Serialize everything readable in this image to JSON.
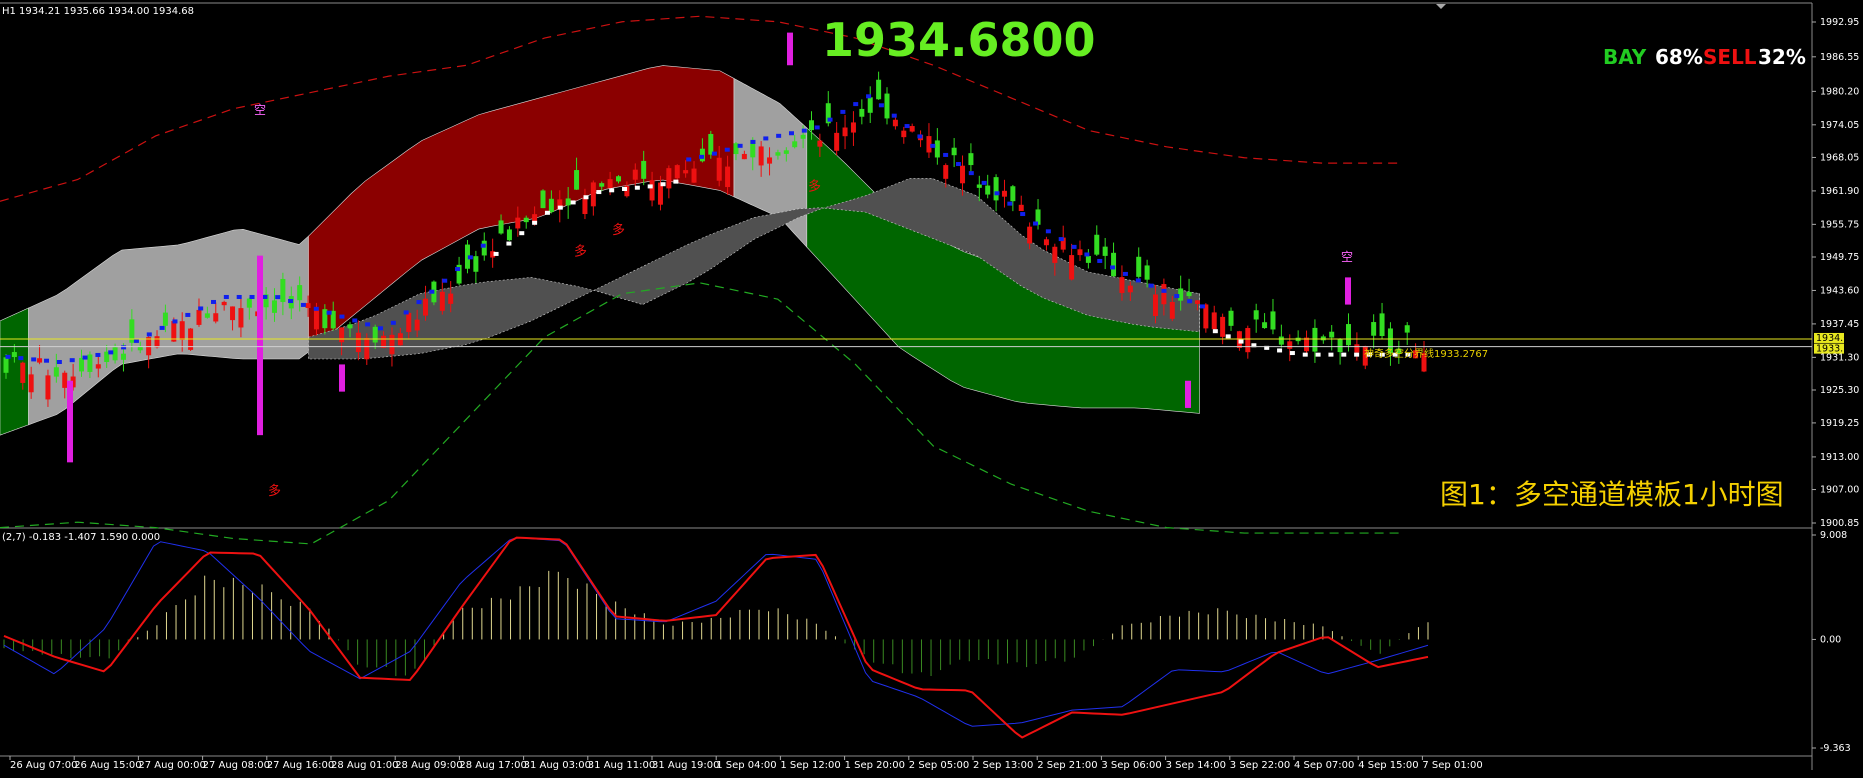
{
  "header": {
    "ohlc_info": "H1  1934.21 1935.66 1934.00 1934.68",
    "osc_info": "(2,7) -0.183 -1.407 1.590 0.000",
    "big_price": "1934.6800",
    "caption": "图1：多空通道模板1小时图",
    "level_label": "神奇多空分界线1933.2767",
    "bay_label": "BAY",
    "bay_value": "68%",
    "sell_label": "SELL",
    "sell_value": "32%",
    "signal_up": "多",
    "signal_down": "空"
  },
  "price_tags": {
    "current": "1934.68",
    "level": "1933.28"
  },
  "colors": {
    "background": "#000000",
    "bull_candle": "#33dd22",
    "bear_candle": "#ee1111",
    "red_band": "#8b0000",
    "green_band": "#006600",
    "gray_band": "#a0a0a0",
    "dark_band": "#555555",
    "blue_trail": "#1020ee",
    "magenta_spike": "#e020e0",
    "yellow_level": "#e8e820"
  },
  "chart_data": [
    {
      "type": "candlestick",
      "title": "",
      "ylim": [
        1900.85,
        1992.95
      ],
      "y_ticks": [
        "1992.95",
        "1986.55",
        "1980.20",
        "1974.05",
        "1968.05",
        "1961.90",
        "1955.75",
        "1949.75",
        "1943.60",
        "1937.45",
        "1931.30",
        "1925.30",
        "1919.25",
        "1913.00",
        "1907.00",
        "1900.85"
      ],
      "x_ticks": [
        "26 Aug 07:00",
        "26 Aug 15:00",
        "27 Aug 00:00",
        "27 Aug 08:00",
        "27 Aug 16:00",
        "28 Aug 01:00",
        "28 Aug 09:00",
        "28 Aug 17:00",
        "31 Aug 03:00",
        "31 Aug 11:00",
        "31 Aug 19:00",
        "1 Sep 04:00",
        "1 Sep 12:00",
        "1 Sep 20:00",
        "2 Sep 05:00",
        "2 Sep 13:00",
        "2 Sep 21:00",
        "3 Sep 06:00",
        "3 Sep 14:00",
        "3 Sep 22:00",
        "4 Sep 07:00",
        "4 Sep 15:00",
        "7 Sep 01:00"
      ],
      "current_price": 1934.68,
      "level_price": 1933.2767,
      "mid_line": [
        1930,
        1929,
        1931,
        1936,
        1941,
        1941,
        1938,
        1935,
        1943,
        1952,
        1960,
        1964,
        1965,
        1967,
        1970,
        1972,
        1978,
        1970,
        1963,
        1955,
        1949,
        1944,
        1940,
        1936,
        1934,
        1934,
        1934
      ],
      "upper_band": [
        1938,
        1943,
        1951,
        1952,
        1955,
        1952,
        1963,
        1971,
        1976,
        1979,
        1982,
        1985,
        1984,
        1978,
        1968,
        1957,
        1951,
        1947,
        1944,
        1943,
        1943
      ],
      "lower_band": [
        1917,
        1921,
        1930,
        1932,
        1931,
        1931,
        1940,
        1949,
        1955,
        1957,
        1962,
        1964,
        1962,
        1957,
        1945,
        1933,
        1926,
        1923,
        1922,
        1922,
        1921
      ]
    },
    {
      "type": "oscillator",
      "ylim": [
        -9.363,
        9.008
      ],
      "y_ticks": [
        "9.008",
        "0.00",
        "-9.363"
      ],
      "red_line": [
        0.3,
        -1.5,
        -2.8,
        3,
        7.5,
        7.4,
        2.6,
        -3.3,
        -3.5,
        2.8,
        8.8,
        8.6,
        2,
        1.6,
        2.1,
        7,
        7.3,
        -2.5,
        -4.3,
        -4.4,
        -8.5,
        -6.3,
        -6.5,
        -5.5,
        -4.5,
        -1.2,
        0.3,
        -2.4,
        -1.5
      ],
      "blue_line": [
        -0.5,
        -3,
        1,
        8.5,
        7.6,
        3.6,
        -1,
        -3.4,
        -1,
        5,
        8.8,
        8.5,
        1.8,
        1.5,
        3.3,
        7.4,
        6.9,
        -3.5,
        -5,
        -7.5,
        -7.2,
        -6.1,
        -5.8,
        -2.6,
        -2.8,
        -1,
        -3,
        -1.8,
        -0.5
      ],
      "histogram": [
        -1,
        -1.5,
        -2,
        1.5,
        6.2,
        5,
        3.2,
        -2.5,
        -3.8,
        3,
        4.5,
        6.7,
        3.5,
        1.5,
        2,
        3.3,
        1.5,
        -2,
        -3.6,
        -2,
        -2.5,
        -2,
        1.3,
        2.5,
        2.8,
        2,
        1.2,
        -1.5,
        1.8
      ]
    }
  ]
}
